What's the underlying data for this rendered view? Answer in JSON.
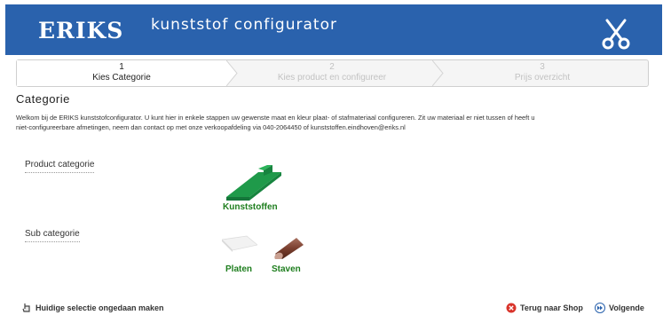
{
  "header": {
    "logo_text": "ERIKS",
    "app_title": "kunststof configurator",
    "brand_color": "#2a62ad",
    "tool_icon": "scissors-icon"
  },
  "steps": [
    {
      "number": "1",
      "label": "Kies Categorie",
      "state": "active"
    },
    {
      "number": "2",
      "label": "Kies product en configureer",
      "state": "inactive"
    },
    {
      "number": "3",
      "label": "Prijs overzicht",
      "state": "inactive"
    }
  ],
  "section": {
    "title": "Categorie",
    "intro": "Welkom bij de ERIKS kunststofconfigurator. U kunt hier in enkele stappen uw gewenste maat en kleur plaat- of stafmateriaal configureren. Zit uw materiaal er niet tussen of heeft u niet-configureerbare afmetingen, neem dan contact op met onze verkoopafdeling via 040-2064450 of kunststoffen.eindhoven@eriks.nl"
  },
  "product_category": {
    "label": "Product categorie",
    "options": [
      {
        "name": "Kunststoffen",
        "image": "green-profile-image"
      }
    ]
  },
  "sub_category": {
    "label": "Sub categorie",
    "options": [
      {
        "name": "Platen",
        "image": "white-plate-image"
      },
      {
        "name": "Staven",
        "image": "brown-rod-image"
      }
    ]
  },
  "footer": {
    "undo_label": "Huidige selectie ongedaan maken",
    "back_label": "Terug naar Shop",
    "next_label": "Volgende"
  },
  "colors": {
    "caption_green": "#1e7e1e",
    "inactive_step_text": "#c2c2c2",
    "back_icon_red": "#d9342b",
    "next_icon_blue": "#2a62ad"
  }
}
